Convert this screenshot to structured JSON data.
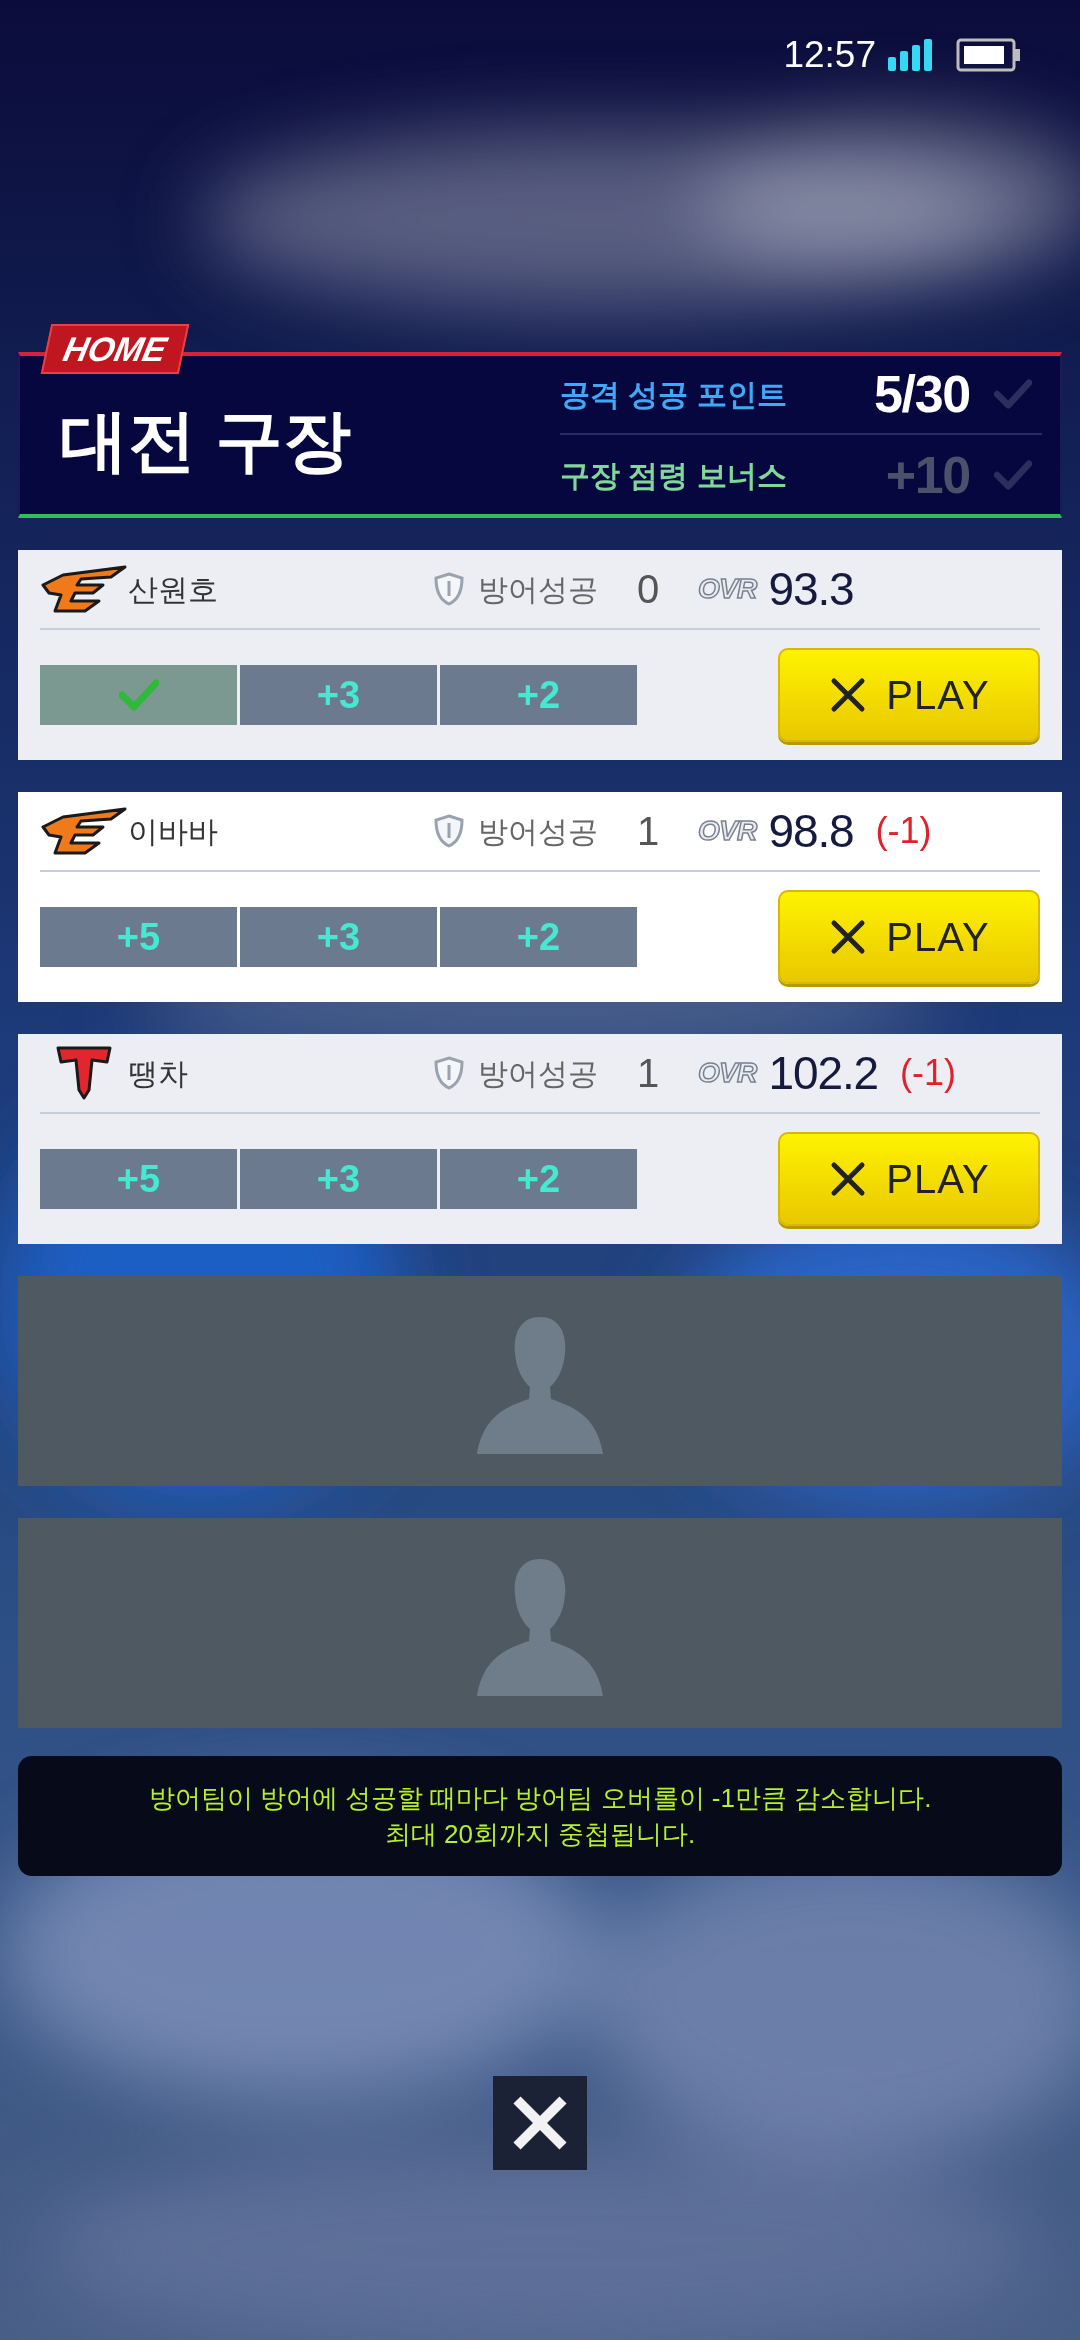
{
  "status_bar": {
    "time": "12:57"
  },
  "header": {
    "tag": "HOME",
    "title": "대전 구장",
    "stats": [
      {
        "label": "공격 성공 포인트",
        "value": "5/30",
        "active": true,
        "checked": false,
        "color": "#3fa9f5"
      },
      {
        "label": "구장 점령 보너스",
        "value": "+10",
        "active": false,
        "checked": false,
        "color": "#7fd89a"
      }
    ]
  },
  "slots": [
    {
      "kind": "player",
      "logo": {
        "kind": "eagle"
      },
      "name": "산원호",
      "defense_label": "방어성공",
      "defense_count": "0",
      "ovr_label": "OVR",
      "ovr": "93.3",
      "bonuses": [
        {
          "done": true
        },
        {
          "label": "+3",
          "done": false
        },
        {
          "label": "+2",
          "done": false
        }
      ],
      "play": "PLAY"
    },
    {
      "kind": "player",
      "logo": {
        "kind": "eagle"
      },
      "name": "이바바",
      "defense_label": "방어성공",
      "defense_count": "1",
      "ovr_label": "OVR",
      "ovr": "98.8",
      "penalty": "(-1)",
      "bonuses": [
        {
          "label": "+5",
          "done": false
        },
        {
          "label": "+3",
          "done": false
        },
        {
          "label": "+2",
          "done": false
        }
      ],
      "play": "PLAY"
    },
    {
      "kind": "player",
      "logo": {
        "kind": "t"
      },
      "name": "땡차",
      "defense_label": "방어성공",
      "defense_count": "1",
      "ovr_label": "OVR",
      "ovr": "102.2",
      "penalty": "(-1)",
      "bonuses": [
        {
          "label": "+5",
          "done": false
        },
        {
          "label": "+3",
          "done": false
        },
        {
          "label": "+2",
          "done": false
        }
      ],
      "play": "PLAY"
    },
    {
      "kind": "empty"
    },
    {
      "kind": "empty"
    }
  ],
  "notice": {
    "lines": [
      "방어팀이 방어에 성공할 때마다 방어팀 오버롤이 -1만큼 감소합니다.",
      "최대 20회까지 중첩됩니다."
    ]
  }
}
